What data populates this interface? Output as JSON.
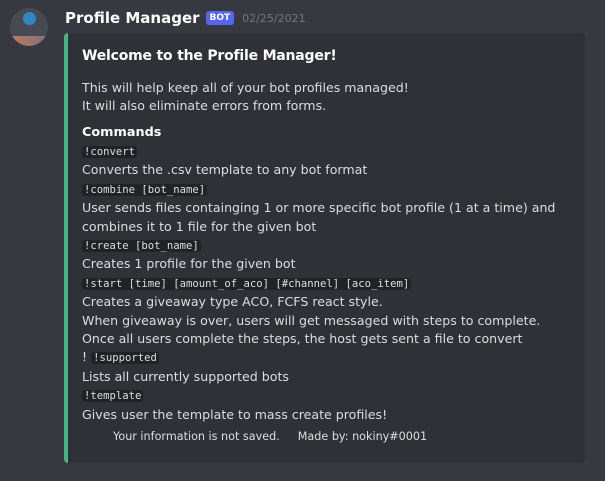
{
  "message": {
    "username": "Profile Manager",
    "bot_tag": "BOT",
    "timestamp": "02/25/2021"
  },
  "embed": {
    "accent_color": "#43b581",
    "title": "Welcome to the Profile Manager!",
    "description": [
      "This will help keep all of your bot profiles managed!",
      "It will also eliminate errors from forms."
    ],
    "field_name": "Commands",
    "commands": [
      {
        "prefix": "",
        "code": "!convert",
        "lines": [
          "Converts the .csv template to any bot format"
        ]
      },
      {
        "prefix": "",
        "code": "!combine [bot_name]",
        "lines": [
          "User sends files containging 1 or more specific bot profile (1 at a time) and combines it to 1 file for the given bot"
        ]
      },
      {
        "prefix": "",
        "code": "!create [bot_name]",
        "lines": [
          "Creates 1 profile for the given bot"
        ]
      },
      {
        "prefix": "",
        "code": "!start [time] [amount_of_aco] [#channel] [aco_item]",
        "lines": [
          "Creates a giveaway type ACO, FCFS react style.",
          "When giveaway is over, users will get messaged with steps to complete.",
          "Once all users complete the steps, the host gets sent a file to convert"
        ]
      },
      {
        "prefix": "! ",
        "code": "!supported",
        "lines": [
          "Lists all currently supported bots"
        ]
      },
      {
        "prefix": "",
        "code": "!template",
        "lines": [
          "Gives user the template to mass create profiles!"
        ]
      }
    ],
    "footer": {
      "left": "Your information is not saved.",
      "right": "Made by: nokiny#0001"
    }
  }
}
